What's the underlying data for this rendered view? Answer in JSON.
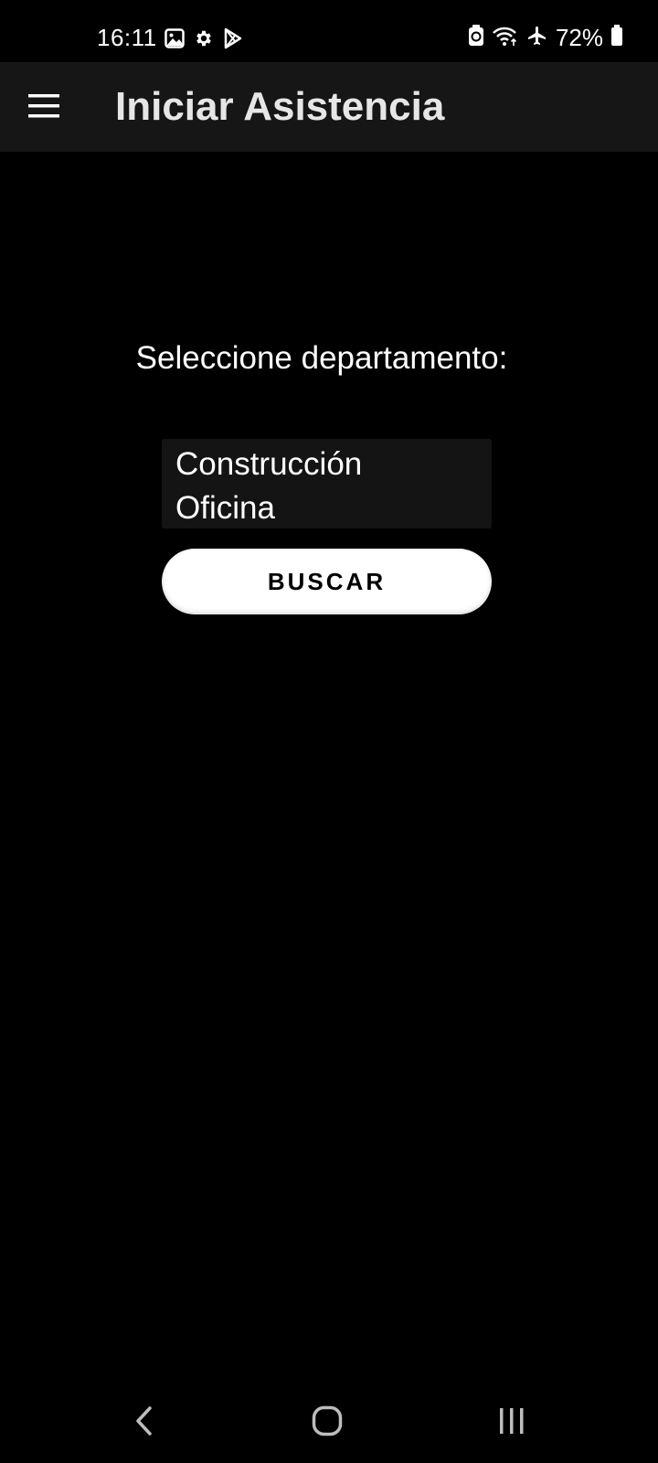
{
  "status_bar": {
    "time": "16:11",
    "left_icons": [
      "gallery-icon",
      "settings-icon",
      "play-store-icon"
    ],
    "right_icons": [
      "battery-saver-icon",
      "wifi-icon",
      "airplane-mode-icon",
      "battery-icon"
    ],
    "battery_percent": "72%"
  },
  "app_bar": {
    "menu_icon": "hamburger-menu-icon",
    "title": "Iniciar Asistencia"
  },
  "main": {
    "prompt": "Seleccione departamento:",
    "departments": [
      "Construcción",
      "Oficina"
    ],
    "search_button_label": "BUSCAR"
  },
  "nav_bar": {
    "buttons": [
      "back-icon",
      "home-icon",
      "recents-icon"
    ]
  },
  "colors": {
    "background": "#000000",
    "app_bar": "#161616",
    "list_background": "#141414",
    "button_background": "#ffffff",
    "button_text": "#000000"
  }
}
